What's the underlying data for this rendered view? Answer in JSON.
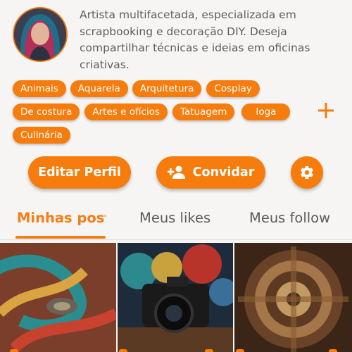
{
  "profile": {
    "avatar_icon": "user-avatar-photo",
    "bio": "Artista multifacetada, especializada em scrapbooking e decoração DIY. Deseja compartilhar técnicas e ideias em oficinas criativas."
  },
  "tags": [
    "Animais",
    "Aquarela",
    "Arquitetura",
    "Cosplay",
    "De costura",
    "Artes e ofícios",
    "Tatuagem",
    "Ioga",
    "Culinária"
  ],
  "add_tag_icon": "plus-icon",
  "buttons": {
    "edit_profile": "Editar Perfil",
    "invite": "Convidar",
    "invite_icon": "person-add-icon",
    "settings_icon": "gear-icon"
  },
  "tabs": [
    "Minhas posts",
    "Meus likes",
    "Meus follow"
  ],
  "active_tab": 0,
  "posts": [
    {
      "icon": "photo-thumbnail"
    },
    {
      "icon": "photo-thumbnail"
    },
    {
      "icon": "photo-thumbnail"
    }
  ],
  "colors": {
    "accent": "#f57c0d",
    "background": "#f7f5f3",
    "text": "#5e5e5e"
  }
}
